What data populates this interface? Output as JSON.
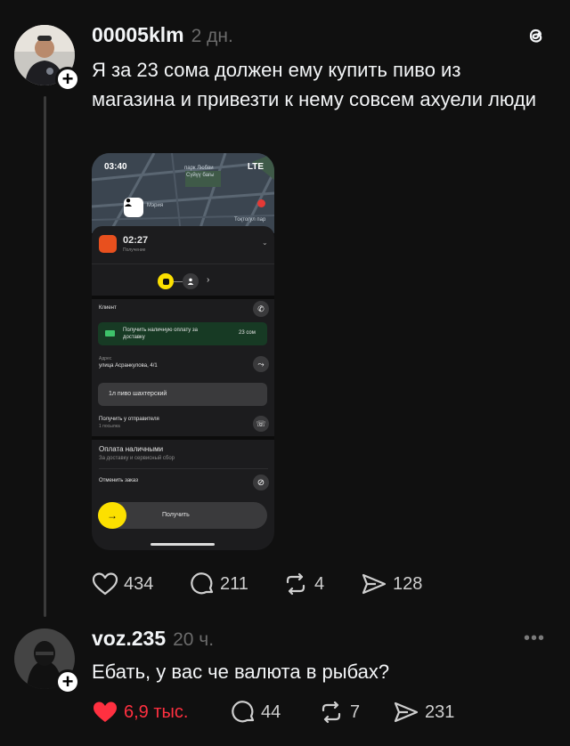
{
  "post": {
    "username": "00005klm",
    "time": "2 дн.",
    "text": "Я за 23 сома должен ему купить пиво из магазина и привезти к нему совсем ахуели люди",
    "likes": "434",
    "replies": "211",
    "reposts": "4",
    "shares": "128"
  },
  "phone": {
    "status_time": "03:40",
    "status_net": "LTE",
    "map_labels": [
      "парк Любви",
      "Сүйүү бағы",
      "Тоқтогул пар",
      "Мэрия"
    ],
    "timer": "02:27",
    "timer_sub": "Получение",
    "client_label": "Клиент",
    "cash_notice": "Получить наличную оплату за доставку",
    "cash_amount": "23 сом",
    "address_label": "Адрес",
    "address_value": "улица Асранкулова, 4/1",
    "item": "1л пиво шахтерский",
    "pickup_label": "Получить у отправителя",
    "pickup_sub": "1 посылка",
    "payment_title": "Оплата наличными",
    "payment_sub": "За доставку и сервисный сбор",
    "cancel_label": "Отменить заказ",
    "receive_button": "Получить"
  },
  "reply": {
    "username": "voz.235",
    "time": "20 ч.",
    "text": "Ебать, у вас че валюта в рыбах?",
    "likes": "6,9 тыс.",
    "replies": "44",
    "reposts": "7",
    "shares": "231"
  },
  "colors": {
    "like_active": "#ff3040",
    "accent_yellow": "#fce000",
    "background": "#101010"
  }
}
